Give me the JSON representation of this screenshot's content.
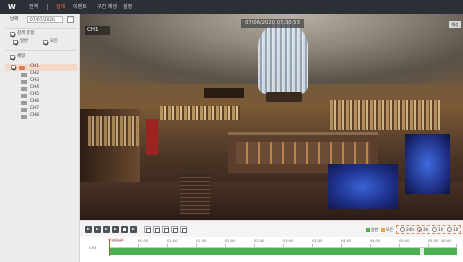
{
  "app": {
    "logo_text": "W",
    "nav": [
      "전역",
      "검색",
      "이벤트",
      "구간 재생",
      "설정"
    ],
    "active_nav_index": 1
  },
  "sidebar": {
    "date_label": "날짜",
    "date_value": "07/07/2020",
    "filter_all_label": "검색 유형",
    "filter_options": [
      {
        "label": "일반",
        "checked": true
      },
      {
        "label": "모든",
        "checked": true
      }
    ],
    "group_label": "채널",
    "channels": [
      "CH1",
      "CH2",
      "CH3",
      "CH4",
      "CH5",
      "CH6",
      "CH7",
      "CH8"
    ],
    "selected_channel_index": 0
  },
  "video": {
    "timestamp": "07/06/2020 07:30:53",
    "channel_label": "CH1",
    "corner_button": "해상"
  },
  "controls": {
    "legend": [
      {
        "label": "일반",
        "color": "#4caf50"
      },
      {
        "label": "모든",
        "color": "#f2a23a"
      }
    ],
    "speeds": [
      {
        "label": "24h",
        "selected": false
      },
      {
        "label": "3h",
        "selected": true
      },
      {
        "label": "1h",
        "selected": false
      },
      {
        "label": "10",
        "selected": false
      }
    ]
  },
  "timeline": {
    "row_label": "CH1",
    "cursor_label": "00:00:00",
    "ticks": [
      "00:00",
      "00:30",
      "01:00",
      "01:30",
      "02:00",
      "02:30",
      "03:00",
      "03:30",
      "04:00",
      "04:30",
      "05:00",
      "05:30",
      "06:00"
    ]
  },
  "colors": {
    "accent": "#ff6a3d",
    "record": "#4caf50",
    "topbar": "#2b2f36"
  }
}
